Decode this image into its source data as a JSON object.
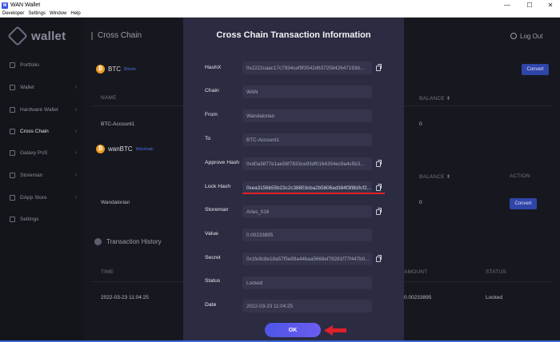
{
  "window": {
    "title": "WAN Wallet",
    "app_icon": "W",
    "minimize": "—",
    "maximize": "☐",
    "close": "✕"
  },
  "menu": [
    "Developer",
    "Settings",
    "Window",
    "Help"
  ],
  "sidebar": {
    "logo_text": "wallet",
    "items": [
      {
        "label": "Portfolio",
        "chevron": ""
      },
      {
        "label": "Wallet",
        "chevron": "›"
      },
      {
        "label": "Hardware Wallet",
        "chevron": "›"
      },
      {
        "label": "Cross Chain",
        "chevron": "›"
      },
      {
        "label": "Galaxy PoS",
        "chevron": "›"
      },
      {
        "label": "Storeman",
        "chevron": "›"
      },
      {
        "label": "DApp Store",
        "chevron": "›"
      },
      {
        "label": "Settings",
        "chevron": ""
      }
    ]
  },
  "header": {
    "title": "Cross Chain",
    "logout": "Log Out"
  },
  "btc_section": {
    "coin": "BTC",
    "coin_icon": "₿",
    "sub": "Bitcoin",
    "button": "Convert",
    "col_name": "NAME",
    "col_balance": "BALANCE ⬍",
    "row_name": "BTC-Account1",
    "row_balance": "0"
  },
  "wanbtc_section": {
    "coin": "wanBTC",
    "coin_icon": "₿",
    "sub": "Wanchain",
    "col_balance": "BALANCE ⬍",
    "col_action": "ACTION",
    "row_name": "Wandalorian",
    "row_balance": "0",
    "button": "Convert"
  },
  "history": {
    "title": "Transaction History",
    "col_time": "TIME",
    "col_amount": "AMOUNT",
    "col_status": "STATUS",
    "row_time": "2022-03-23 11:04:25",
    "row_amount": "0.00233895",
    "row_status": "Locked"
  },
  "modal": {
    "title": "Cross Chain Transaction Information",
    "rows": [
      {
        "label": "HashX",
        "value": "0x2222caac17c7934cef9f3542d63725842647193d..."
      },
      {
        "label": "Chain",
        "value": "WAN"
      },
      {
        "label": "From",
        "value": "Wandalorian"
      },
      {
        "label": "To",
        "value": "BTC-Account1"
      },
      {
        "label": "Approve Hash",
        "value": "0xd0a3877e1ae56f7833ce93df0164354ec9a4c5b3..."
      },
      {
        "label": "Lock Hash",
        "value": "0xea3156b55b23c2c38803cba2b5606ad384f3f8b0cf2..."
      },
      {
        "label": "Storeman",
        "value": "Aries_016"
      },
      {
        "label": "Value",
        "value": "0.00233895"
      },
      {
        "label": "Secret",
        "value": "0x1fe9c8e18a57f5e89a44baa5668ef78281f77f447b0..."
      },
      {
        "label": "Status",
        "value": "Locked"
      },
      {
        "label": "Date",
        "value": "2022-03-23 11:04:25"
      }
    ],
    "ok": "OK"
  },
  "colors": {
    "accent": "#5058e8",
    "highlight": "#e0202a",
    "modal_bg": "#2b2b41",
    "app_bg": "#17181f"
  }
}
